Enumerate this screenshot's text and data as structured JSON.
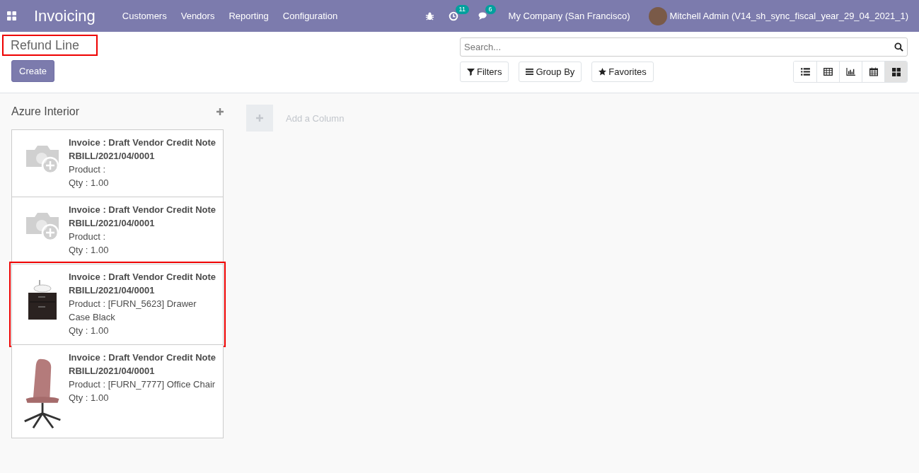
{
  "navbar": {
    "app_name": "Invoicing",
    "menus": [
      "Customers",
      "Vendors",
      "Reporting",
      "Configuration"
    ],
    "activity_count": "11",
    "message_count": "6",
    "company": "My Company (San Francisco)",
    "user": "Mitchell Admin (V14_sh_sync_fiscal_year_29_04_2021_1)"
  },
  "control_panel": {
    "title": "Refund Line",
    "title_highlighted": true,
    "create_button": "Create",
    "search": {
      "placeholder": "Search..."
    },
    "filters": [
      "Filters",
      "Group By",
      "Favorites"
    ],
    "views": [
      {
        "kind": "list",
        "selected": false
      },
      {
        "kind": "pivot",
        "selected": false
      },
      {
        "kind": "graph",
        "selected": false
      },
      {
        "kind": "calendar",
        "selected": false
      },
      {
        "kind": "kanban",
        "selected": true
      }
    ]
  },
  "kanban": {
    "column": {
      "title": "Azure Interior",
      "cards": [
        {
          "kind": "placeholder",
          "highlighted": false,
          "title": "Invoice : Draft Vendor Credit Note",
          "reference": "RBILL/2021/04/0001",
          "product": "Product :",
          "qty": "Qty : 1.00"
        },
        {
          "kind": "placeholder",
          "highlighted": false,
          "title": "Invoice : Draft Vendor Credit Note",
          "reference": "RBILL/2021/04/0001",
          "product": "Product :",
          "qty": "Qty : 1.00"
        },
        {
          "kind": "cabinet",
          "highlighted": true,
          "title": "Invoice : Draft Vendor Credit Note",
          "reference": "RBILL/2021/04/0001",
          "product": "Product : [FURN_5623] Drawer Case Black",
          "qty": "Qty : 1.00"
        },
        {
          "kind": "chair",
          "highlighted": false,
          "title": "Invoice : Draft Vendor Credit Note",
          "reference": "RBILL/2021/04/0001",
          "product": "Product : [FURN_7777] Office Chair",
          "qty": "Qty : 1.00"
        }
      ]
    },
    "add_column": "Add a Column"
  }
}
